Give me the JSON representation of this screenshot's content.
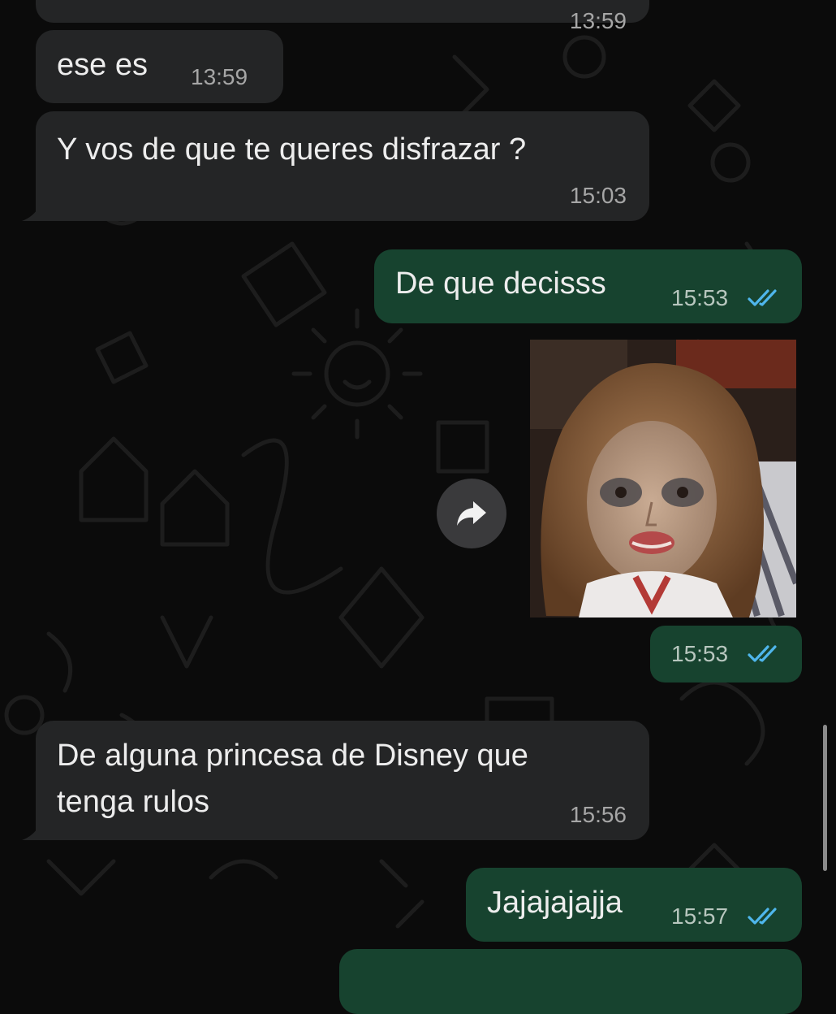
{
  "messages": [
    {
      "direction": "incoming",
      "text": "",
      "time": "13:59"
    },
    {
      "direction": "incoming",
      "text": "ese es",
      "time": "13:59"
    },
    {
      "direction": "incoming",
      "text": "Y vos de que te queres disfrazar ?",
      "time": "15:03"
    },
    {
      "direction": "outgoing",
      "text": "De que decisss",
      "time": "15:53",
      "status": "read"
    },
    {
      "direction": "outgoing",
      "type": "image",
      "time": "15:53",
      "status": "read"
    },
    {
      "direction": "incoming",
      "lines": [
        "De alguna princesa de Disney que",
        "tenga rulos"
      ],
      "time": "15:56"
    },
    {
      "direction": "outgoing",
      "text": "Jajajajajja",
      "time": "15:57",
      "status": "read"
    }
  ],
  "icons": {
    "forward": "forward-arrow-icon",
    "read_receipt": "double-check-icon"
  },
  "colors": {
    "incoming": "#242526",
    "outgoing": "#17432f",
    "read_tick": "#4fb6ec",
    "background": "#0b0b0b"
  }
}
